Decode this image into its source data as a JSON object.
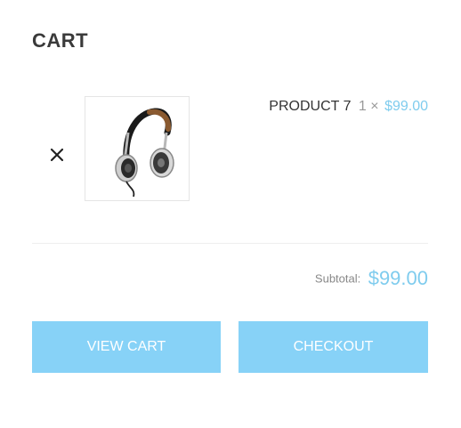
{
  "cart": {
    "title": "CART",
    "items": [
      {
        "name": "PRODUCT 7",
        "quantity": "1 ×",
        "price": "$99.00",
        "image": "headphones-image",
        "remove_icon": "close-icon"
      }
    ],
    "subtotal_label": "Subtotal:",
    "subtotal_value": "$99.00",
    "view_cart_label": "VIEW CART",
    "checkout_label": "CHECKOUT"
  },
  "colors": {
    "accent": "#7fccee",
    "button_bg": "#87d2f7",
    "button_text": "#ffffff",
    "title": "#3a3a3a"
  }
}
